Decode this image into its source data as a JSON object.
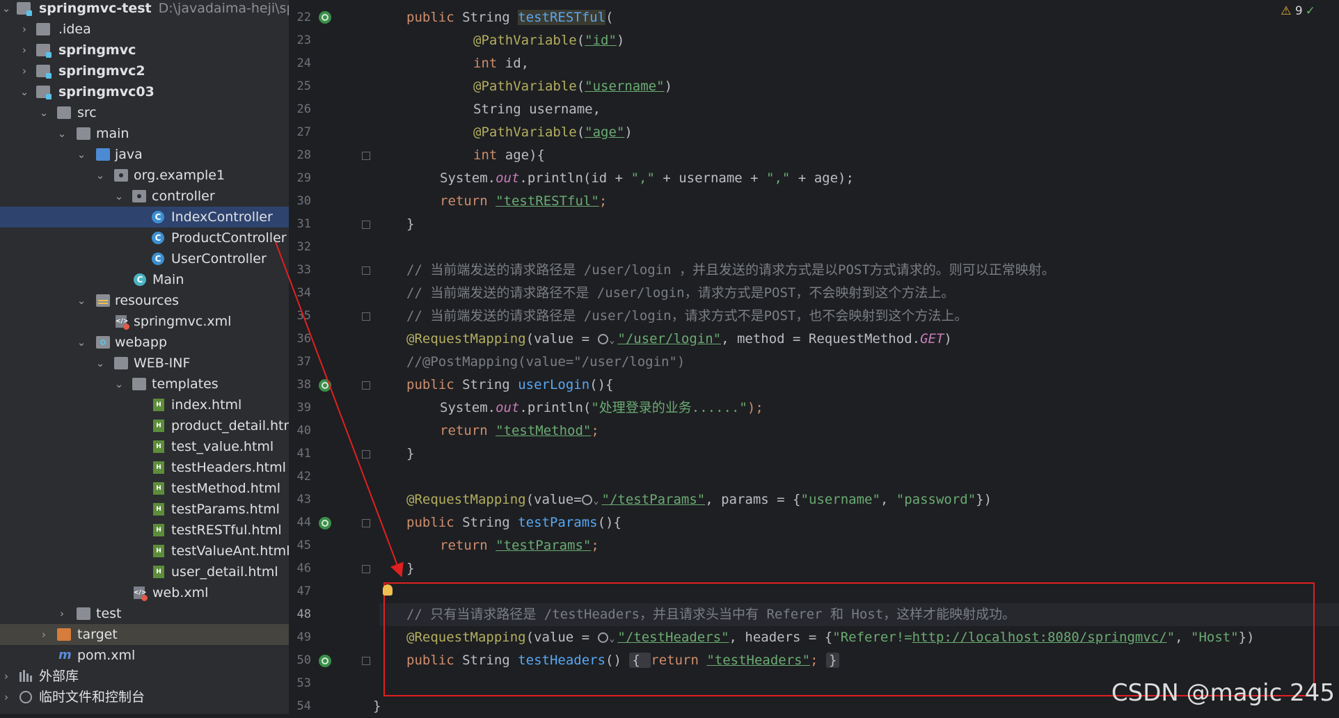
{
  "project_tree": {
    "root": {
      "name": "springmvc-test",
      "path": "D:\\javadaima-heji\\spring"
    },
    "items": [
      {
        "label": "springmvc-test",
        "path": "D:\\javadaima-heji\\spring"
      },
      {
        "label": ".idea"
      },
      {
        "label": "springmvc"
      },
      {
        "label": "springmvc2"
      },
      {
        "label": "springmvc03"
      },
      {
        "label": "src"
      },
      {
        "label": "main"
      },
      {
        "label": "java"
      },
      {
        "label": "org.example1"
      },
      {
        "label": "controller"
      },
      {
        "label": "IndexController"
      },
      {
        "label": "ProductController"
      },
      {
        "label": "UserController"
      },
      {
        "label": "Main"
      },
      {
        "label": "resources"
      },
      {
        "label": "springmvc.xml"
      },
      {
        "label": "webapp"
      },
      {
        "label": "WEB-INF"
      },
      {
        "label": "templates"
      },
      {
        "label": "index.html"
      },
      {
        "label": "product_detail.html"
      },
      {
        "label": "test_value.html"
      },
      {
        "label": "testHeaders.html"
      },
      {
        "label": "testMethod.html"
      },
      {
        "label": "testParams.html"
      },
      {
        "label": "testRESTful.html"
      },
      {
        "label": "testValueAnt.html"
      },
      {
        "label": "user_detail.html"
      },
      {
        "label": "web.xml"
      },
      {
        "label": "test"
      },
      {
        "label": "target"
      },
      {
        "label": "pom.xml"
      },
      {
        "label": "外部库"
      },
      {
        "label": "临时文件和控制台"
      }
    ]
  },
  "editor": {
    "line_numbers": [
      "22",
      "23",
      "24",
      "25",
      "26",
      "27",
      "28",
      "29",
      "30",
      "31",
      "32",
      "33",
      "34",
      "35",
      "36",
      "37",
      "38",
      "39",
      "40",
      "41",
      "42",
      "43",
      "44",
      "45",
      "46",
      "47",
      "48",
      "49",
      "50",
      "53",
      "54"
    ],
    "lines": {
      "l22": {
        "kw": "public",
        "type": "String",
        "fn": "testRESTful",
        "rest": "("
      },
      "l23": {
        "ann": "@PathVariable",
        "open": "(",
        "str": "\"id\"",
        "close": ")"
      },
      "l24": {
        "kw": "int",
        "rest": "id,"
      },
      "l25": {
        "ann": "@PathVariable",
        "open": "(",
        "str": "\"username\"",
        "close": ")"
      },
      "l26": {
        "rest": "String username,"
      },
      "l27": {
        "ann": "@PathVariable",
        "open": "(",
        "str": "\"age\"",
        "close": ")"
      },
      "l28": {
        "kw": "int",
        "rest": "age){"
      },
      "l29": {
        "a": "System.",
        "field": "out",
        "b": ".println(id + ",
        "s1": "\",\"",
        "c": " + username + ",
        "s2": "\",\"",
        "d": " + age);"
      },
      "l30": {
        "kw": "return",
        "str": "\"testRESTful\"",
        "rest": ";"
      },
      "l31": {
        "rest": "}"
      },
      "l33": {
        "cmt": "// 当前端发送的请求路径是 /user/login ，并且发送的请求方式是以POST方式请求的。则可以正常映射。"
      },
      "l34": {
        "cmt": "// 当前端发送的请求路径不是 /user/login，请求方式是POST，不会映射到这个方法上。"
      },
      "l35": {
        "cmt": "// 当前端发送的请求路径是 /user/login，请求方式不是POST，也不会映射到这个方法上。"
      },
      "l36": {
        "ann": "@RequestMapping",
        "a": "(value = ",
        "str": "\"/user/login\"",
        "b": ", method = RequestMethod.",
        "field": "GET",
        "c": ")"
      },
      "l37": {
        "cmt": "//@PostMapping(value=\"/user/login\")"
      },
      "l38": {
        "kw": "public",
        "type": "String",
        "fn": "userLogin",
        "rest": "(){"
      },
      "l39": {
        "a": "System.",
        "field": "out",
        "b": ".println(",
        "str": "\"处理登录的业务......\"",
        "c": ");"
      },
      "l40": {
        "kw": "return",
        "str": "\"testMethod\"",
        "rest": ";"
      },
      "l41": {
        "rest": "}"
      },
      "l43": {
        "ann": "@RequestMapping",
        "a": "(value=",
        "str": "\"/testParams\"",
        "b": ", params = {",
        "s1": "\"username\"",
        "c": ", ",
        "s2": "\"password\"",
        "d": "})"
      },
      "l44": {
        "kw": "public",
        "type": "String",
        "fn": "testParams",
        "rest": "(){"
      },
      "l45": {
        "kw": "return",
        "str": "\"testParams\"",
        "rest": ";"
      },
      "l46": {
        "rest": "}"
      },
      "l48": {
        "cmt": "// 只有当请求路径是 /testHeaders，并且请求头当中有 Referer 和 Host，这样才能映射成功。"
      },
      "l49": {
        "ann": "@RequestMapping",
        "a": "(value = ",
        "str": "\"/testHeaders\"",
        "b": ", headers = {",
        "s1": "\"Referer!=",
        "s1u": "http://localhost:8080/springmvc/",
        "s1e": "\"",
        "c": ", ",
        "s2": "\"Host\"",
        "d": "})"
      },
      "l50": {
        "kw": "public",
        "type": "String",
        "fn": "testHeaders",
        "a": "() ",
        "box1": "{ ",
        "kw2": "return",
        "str": "\"testHeaders\"",
        "b": ";",
        "box2": "}"
      },
      "l54": {
        "rest": "}"
      }
    }
  },
  "status": {
    "warnings": "9"
  },
  "watermark": "CSDN @magic 245",
  "colors": {
    "annotation_box": "#e02020",
    "arrow": "#e02020",
    "selection": "#2e436e"
  }
}
